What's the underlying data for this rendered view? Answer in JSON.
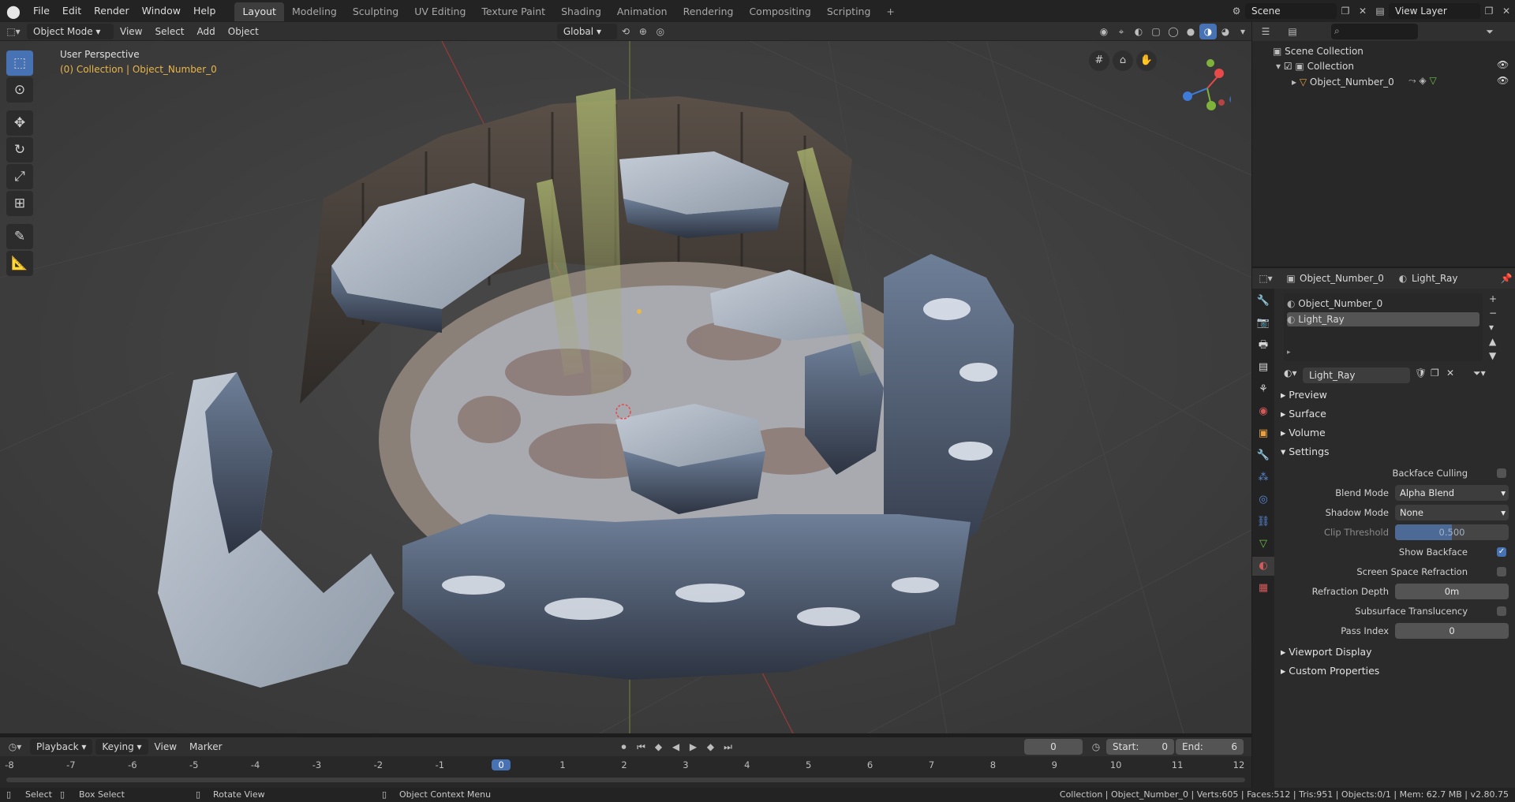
{
  "topbar": {
    "menus": [
      "File",
      "Edit",
      "Render",
      "Window",
      "Help"
    ],
    "workspaces": [
      "Layout",
      "Modeling",
      "Sculpting",
      "UV Editing",
      "Texture Paint",
      "Shading",
      "Animation",
      "Rendering",
      "Compositing",
      "Scripting"
    ],
    "active_workspace": "Layout",
    "scene_name": "Scene",
    "view_layer": "View Layer"
  },
  "viewport_header": {
    "mode": "Object Mode",
    "menus": [
      "View",
      "Select",
      "Add",
      "Object"
    ],
    "orientation": "Global"
  },
  "viewport": {
    "perspective_label": "User Perspective",
    "collection_label": "(0) Collection | Object_Number_0",
    "axes": {
      "x": "X",
      "y": "Y",
      "z": "Z"
    }
  },
  "outliner": {
    "search_placeholder": "",
    "items": [
      {
        "label": "Scene Collection"
      },
      {
        "label": "Collection"
      },
      {
        "label": "Object_Number_0"
      }
    ]
  },
  "properties": {
    "object_name": "Object_Number_0",
    "material_name": "Light_Ray",
    "slots": [
      "Object_Number_0",
      "Light_Ray"
    ],
    "active_slot": "Light_Ray",
    "material_field": "Light_Ray",
    "panels": [
      "Preview",
      "Surface",
      "Volume",
      "Settings"
    ],
    "settings": {
      "backface_culling_label": "Backface Culling",
      "backface_culling": false,
      "blend_mode_label": "Blend Mode",
      "blend_mode": "Alpha Blend",
      "shadow_mode_label": "Shadow Mode",
      "shadow_mode": "None",
      "clip_threshold_label": "Clip Threshold",
      "clip_threshold": "0.500",
      "show_backface_label": "Show Backface",
      "show_backface": true,
      "ssr_label": "Screen Space Refraction",
      "ssr": false,
      "refraction_depth_label": "Refraction Depth",
      "refraction_depth": "0m",
      "subsurface_label": "Subsurface Translucency",
      "subsurface": false,
      "pass_index_label": "Pass Index",
      "pass_index": "0"
    },
    "more_panels": [
      "Viewport Display",
      "Custom Properties"
    ]
  },
  "timeline": {
    "menus": [
      "Playback",
      "Keying",
      "View",
      "Marker"
    ],
    "current_frame": "0",
    "start_label": "Start:",
    "start": "0",
    "end_label": "End:",
    "end": "6",
    "ticks": [
      "-8",
      "-7",
      "-6",
      "-5",
      "-4",
      "-3",
      "-2",
      "-1",
      "0",
      "1",
      "2",
      "3",
      "4",
      "5",
      "6",
      "7",
      "8",
      "9",
      "10",
      "11",
      "12"
    ]
  },
  "statusbar": {
    "select": "Select",
    "box_select": "Box Select",
    "rotate_view": "Rotate View",
    "context_menu": "Object Context Menu",
    "stats": "Collection | Object_Number_0 | Verts:605 | Faces:512 | Tris:951 | Objects:0/1 | Mem: 62.7 MB | v2.80.75"
  },
  "colors": {
    "accent": "#4772b3",
    "orange_text": "#e8b64a"
  }
}
